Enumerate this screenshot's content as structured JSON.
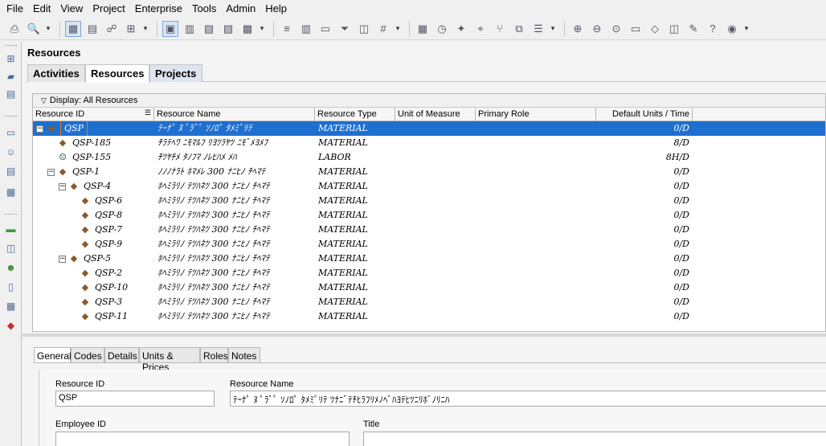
{
  "menu": [
    "File",
    "Edit",
    "View",
    "Project",
    "Enterprise",
    "Tools",
    "Admin",
    "Help"
  ],
  "toolbar": {
    "icons": [
      "print-icon",
      "print-preview-icon",
      "table-view-icon",
      "outline-icon",
      "chart-icon",
      "org-chart-icon",
      "details-icon",
      "report-icon",
      "layout-icon",
      "columns-icon",
      "filter-icon",
      "group-sort-icon",
      "zoom-in-icon",
      "zoom-out-icon",
      "help-icon"
    ]
  },
  "section_title": "Resources",
  "tabs": [
    "Activities",
    "Resources",
    "Projects"
  ],
  "grid": {
    "display_label": "Display: All Resources",
    "columns": [
      "Resource ID",
      "Resource Name",
      "Resource Type",
      "Unit of Measure",
      "Primary Role",
      "Default Units / Time"
    ],
    "rows": [
      {
        "id": "QSP",
        "name": "ﾃｰﾅﾟ ﾇ ﾟﾗﾞﾟ ｿﾉﾛﾟ ﾀﾒﾐﾟﾘﾃ",
        "type": "MATERIAL",
        "units": "0/D",
        "level": 0,
        "expander": "−",
        "icon": "material",
        "selected": true
      },
      {
        "id": "QSP-185",
        "name": "ﾁﾗﾃﾍﾜ ﾆﾓﾏﾙﾌ ﾘﾖﾂﾗﾔﾂ ﾆﾓﾞﾒﾖﾒﾌ",
        "type": "MATERIAL",
        "units": "8/D",
        "level": 1,
        "expander": "",
        "icon": "material",
        "selected": false
      },
      {
        "id": "QSP-155",
        "name": "ﾁﾂﾔﾁﾒ ﾀﾉﾌﾏ ﾉﾚﾋﾊﾒ ﾒﾊ",
        "type": "LABOR",
        "units": "8H/D",
        "level": 1,
        "expander": "",
        "icon": "labor",
        "selected": false
      },
      {
        "id": "QSP-1",
        "name": "ﾉﾉﾉﾅﾗﾄ ﾎﾏﾒﾚ 300 ﾅﾆﾋﾉ ﾁﾍﾏﾃ",
        "type": "MATERIAL",
        "units": "0/D",
        "level": 1,
        "expander": "−",
        "icon": "material",
        "selected": false
      },
      {
        "id": "QSP-4",
        "name": "ﾎﾍﾐﾗﾘﾉ ﾃﾂﾊﾈﾂ 300 ﾅﾆﾋﾉ ﾁﾍﾏﾃ",
        "type": "MATERIAL",
        "units": "0/D",
        "level": 2,
        "expander": "−",
        "icon": "material",
        "selected": false
      },
      {
        "id": "QSP-6",
        "name": "ﾎﾍﾐﾗﾘﾉ ﾃﾂﾊﾈﾂ 300 ﾅﾆﾋﾉ ﾁﾍﾏﾃ",
        "type": "MATERIAL",
        "units": "0/D",
        "level": 3,
        "expander": "",
        "icon": "material",
        "selected": false
      },
      {
        "id": "QSP-8",
        "name": "ﾎﾍﾐﾗﾘﾉ ﾃﾂﾊﾈﾂ 300 ﾅﾆﾋﾉ ﾁﾍﾏﾃ",
        "type": "MATERIAL",
        "units": "0/D",
        "level": 3,
        "expander": "",
        "icon": "material",
        "selected": false
      },
      {
        "id": "QSP-7",
        "name": "ﾎﾍﾐﾗﾘﾉ ﾃﾂﾊﾈﾂ 300 ﾅﾆﾋﾉ ﾁﾍﾏﾃ",
        "type": "MATERIAL",
        "units": "0/D",
        "level": 3,
        "expander": "",
        "icon": "material",
        "selected": false
      },
      {
        "id": "QSP-9",
        "name": "ﾎﾍﾐﾗﾘﾉ ﾃﾂﾊﾈﾂ 300 ﾅﾆﾋﾉ ﾁﾍﾏﾃ",
        "type": "MATERIAL",
        "units": "0/D",
        "level": 3,
        "expander": "",
        "icon": "material",
        "selected": false
      },
      {
        "id": "QSP-5",
        "name": "ﾎﾍﾐﾗﾘﾉ ﾃﾂﾊﾈﾂ 300 ﾅﾆﾋﾉ ﾁﾍﾏﾃ",
        "type": "MATERIAL",
        "units": "0/D",
        "level": 2,
        "expander": "−",
        "icon": "material",
        "selected": false
      },
      {
        "id": "QSP-2",
        "name": "ﾎﾍﾐﾗﾘﾉ ﾃﾂﾊﾈﾂ 300 ﾅﾆﾋﾉ ﾁﾍﾏﾃ",
        "type": "MATERIAL",
        "units": "0/D",
        "level": 3,
        "expander": "",
        "icon": "material",
        "selected": false
      },
      {
        "id": "QSP-10",
        "name": "ﾎﾍﾐﾗﾘﾉ ﾃﾂﾊﾈﾂ 300 ﾅﾆﾋﾉ ﾁﾍﾏﾃ",
        "type": "MATERIAL",
        "units": "0/D",
        "level": 3,
        "expander": "",
        "icon": "material",
        "selected": false
      },
      {
        "id": "QSP-3",
        "name": "ﾎﾍﾐﾗﾘﾉ ﾃﾂﾊﾈﾂ 300 ﾅﾆﾋﾉ ﾁﾍﾏﾃ",
        "type": "MATERIAL",
        "units": "0/D",
        "level": 3,
        "expander": "",
        "icon": "material",
        "selected": false
      },
      {
        "id": "QSP-11",
        "name": "ﾎﾍﾐﾗﾘﾉ ﾃﾂﾊﾈﾂ 300 ﾅﾆﾋﾉ ﾁﾍﾏﾃ",
        "type": "MATERIAL",
        "units": "0/D",
        "level": 3,
        "expander": "",
        "icon": "material",
        "selected": false
      }
    ]
  },
  "detail_tabs": [
    "General",
    "Codes",
    "Details",
    "Units & Prices",
    "Roles",
    "Notes"
  ],
  "detail": {
    "resource_id_label": "Resource ID",
    "resource_id_value": "QSP",
    "resource_name_label": "Resource Name",
    "resource_name_value": "ﾃｰﾅﾟ ﾇ ﾟﾗﾞﾟ ｿﾉﾛﾟ ﾀﾒﾐﾟﾘﾃ ﾂﾅﾆﾞﾃﾁﾋﾗﾌﾘﾒﾉﾍﾞﾊﾖﾃﾋﾂﾆﾘﾎﾞﾉﾘﾆﾊ",
    "employee_id_label": "Employee ID",
    "employee_id_value": "",
    "title_label": "Title",
    "title_value": ""
  },
  "colors": {
    "selection": "#1e6fd0",
    "tab_projects": "#dde5f0"
  }
}
